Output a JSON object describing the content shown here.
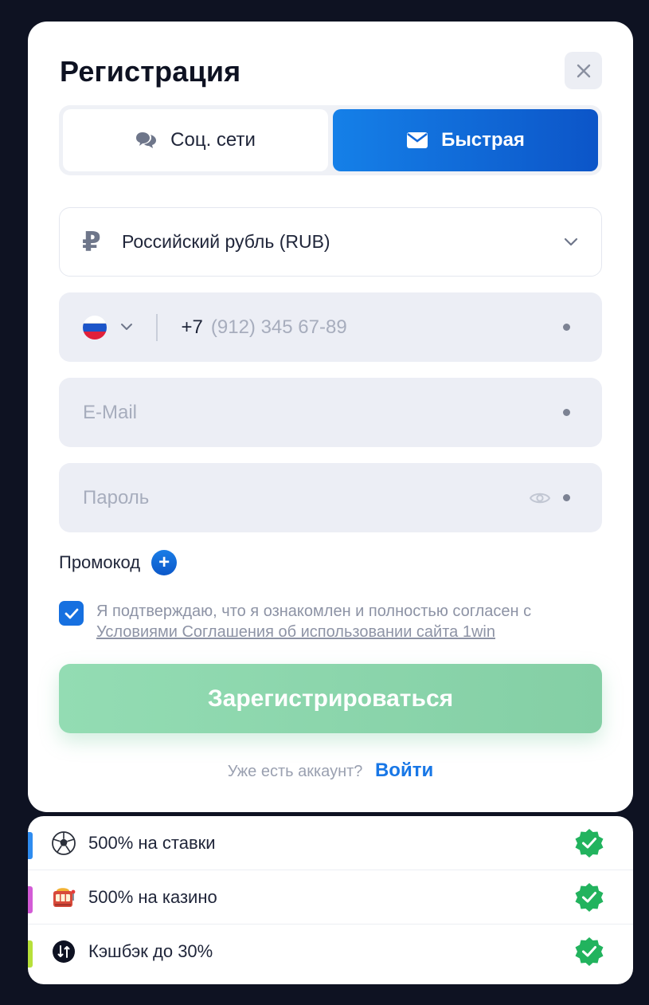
{
  "modal": {
    "title": "Регистрация"
  },
  "tabs": [
    {
      "label": "Соц. сети",
      "icon": "chat-bubbles-icon",
      "active": false
    },
    {
      "label": "Быстрая",
      "icon": "envelope-icon",
      "active": true
    }
  ],
  "form": {
    "currency": {
      "symbol": "₽",
      "label": "Российский рубль (RUB)"
    },
    "phone": {
      "code": "+7",
      "placeholder": "(912) 345 67-89",
      "country_flag": "ru-flag-icon"
    },
    "email": {
      "placeholder": "E-Mail"
    },
    "password": {
      "placeholder": "Пароль"
    },
    "promo_label": "Промокод",
    "agreement": {
      "checked": true,
      "text": "Я подтверждаю, что я ознакомлен и полностью согласен с",
      "link": "Условиями Соглашения об использовании сайта 1win"
    },
    "submit_label": "Зарегистрироваться"
  },
  "login": {
    "prompt": "Уже есть аккаунт?",
    "link": "Войти"
  },
  "bonuses": [
    {
      "label": "500% на ставки",
      "icon": "soccer-ball-icon",
      "bar_color": "#2e8cf0"
    },
    {
      "label": "500% на казино",
      "icon": "slot-machine-icon",
      "bar_color": "#d35bd6"
    },
    {
      "label": "Кэшбэк до 30%",
      "icon": "cashback-icon",
      "bar_color": "#b7e03a"
    }
  ],
  "colors": {
    "accent": "#1670e0",
    "success": "#22b35e",
    "submit_disabled": "#8ed7ad",
    "background": "#0e1222"
  }
}
